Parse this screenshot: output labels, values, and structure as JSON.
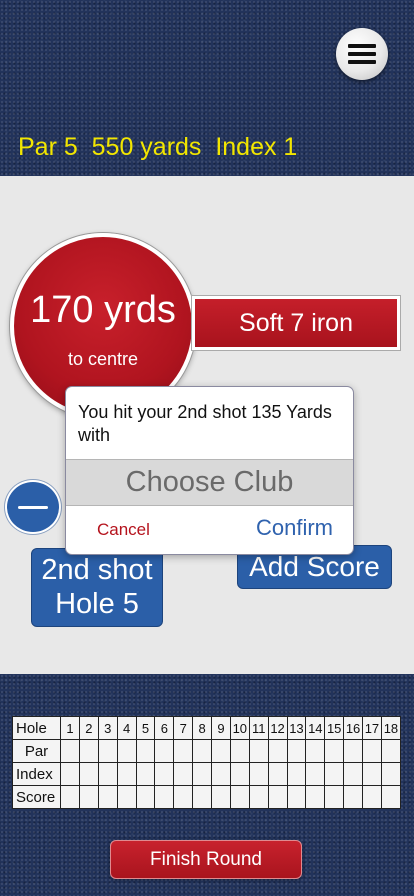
{
  "header": {
    "menu_icon": "hamburger-menu-icon",
    "hole_info": "Par 5  550 yards  Index 1"
  },
  "distance": {
    "value": "170 yrds",
    "caption": "to centre"
  },
  "club_banner": {
    "label": "Soft 7 iron"
  },
  "shot": {
    "line1": "2nd shot",
    "line2": "Hole 5"
  },
  "add_score_label": "Add Score",
  "minus_icon": "minus-icon",
  "dialog": {
    "message": "You hit your 2nd shot 135 Yards with",
    "choose_club": "Choose Club",
    "cancel_label": "Cancel",
    "confirm_label": "Confirm"
  },
  "scorecard": {
    "row_labels": {
      "hole": "Hole",
      "par": "Par",
      "index": "Index",
      "score": "Score"
    },
    "holes": [
      "1",
      "2",
      "3",
      "4",
      "5",
      "6",
      "7",
      "8",
      "9",
      "10",
      "11",
      "12",
      "13",
      "14",
      "15",
      "16",
      "17",
      "18"
    ]
  },
  "finish_label": "Finish Round",
  "colors": {
    "background_navy": "#22335b",
    "hole_info_yellow": "#f2e600",
    "accent_red": "#b5131d",
    "accent_blue": "#2b5fa8",
    "panel_grey": "#e8e8e8"
  }
}
